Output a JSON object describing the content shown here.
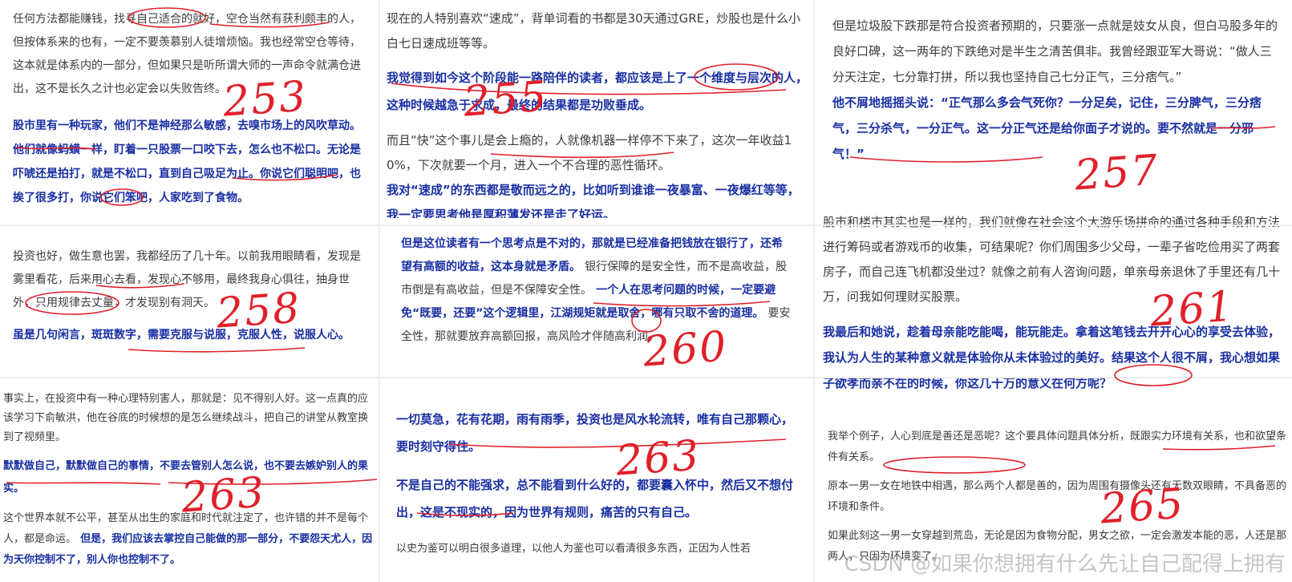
{
  "panels": [
    {
      "normal_1": "任何方法都能赚钱，找寻自己适合的就好，空仓当然有获利颇丰的人，但按体系来的也有，一定不要羡慕别人徒增烦恼。我也经常空仓等待，这本就是体系内的一部分，但如果只是听所谓大师的一声命令就满仓进出，这不是长久之计也必定会以失败告终。",
      "bold_1": "股市里有一种玩家，他们不是神经那么敏感，去嗅市场上的风吹草动。他们就像蚂蟥一样，盯着一只股票一口咬下去，怎么也不松口。无论是吓唬还是拍打，就是不松口，直到自己吸足为止。你说它们聪明吧，也挨了很多打，你说它们笨吧，人家吃到了食物。",
      "mark": "253"
    },
    {
      "normal_1": "现在的人特别喜欢“速成”，背单词看的书都是30天通过GRE，炒股也是什么小白七日速成班等等。",
      "bold_1": "我觉得到如今这个阶段能一路陪伴的读者，都应该是上了一个维度与层次的人，这种时候越急于求成，最终的结果都是功败垂成。",
      "normal_2": "而且“快”这个事儿是会上瘾的，人就像机器一样停不下来了，这次一年收益10%，下次就要一个月，进入一个不合理的恶性循环。",
      "bold_2": "我对“速成”的东西都是敬而远之的，比如听到谁谁一夜暴富、一夜爆红等等，我一定要思考他是厚积薄发还是走了好运。",
      "mark": "255"
    },
    {
      "normal_1": "但是垃圾股下跌那是符合投资者预期的，只要涨一点就是妓女从良，但白马股多年的良好口碑，这一两年的下跌绝对是半生之清苦俱非。我曾经跟亚军大哥说：“做人三分天注定，七分靠打拼，所以我也坚持自己七分正气，三分痞气。”",
      "bold_1": "他不屑地摇摇头说：“正气那么多会气死你？一分足矣，记住，三分脾气，三分痞气，三分杀气，一分正气。这一分正气还是给你面子才说的。要不然就是一分邪气！”",
      "mark": "257"
    },
    {
      "normal_1": "投资也好，做生意也罢，我都经历了几十年。以前我用眼睛看，发现是雾里看花，后来用心去看，发现心不够用，最终我身心俱往，抽身世外，只用规律去丈量，才发现别有洞天。",
      "bold_1": "虽是几句闲言，斑斑数字，需要克服与说服，克服人性，说服人心。",
      "mark": "258"
    },
    {
      "bold_1": "但是这位读者有一个思考点是不对的，那就是已经准备把钱放在银行了，还希望有高额的收益，这本身就是矛盾。",
      "normal_1": "银行保障的是安全性，而不是高收益，股市倒是有高收益，但是不保障安全性。",
      "bold_2": "一个人在思考问题的时候，一定要避免“既要，还要”这个逻辑里，江湖规矩就是取舍，哪有只取不舍的道理。",
      "normal_2": "要安全性，那就要放弃高额回报，高风险才伴随高利润。",
      "mark": "260"
    },
    {
      "normal_1": "股市和楼市其实也是一样的，我们就像在社会这个大游乐场拼命的通过各种手段和方法进行筹码或者游戏币的收集，可结果呢？你们周围多少父母，一辈子省吃俭用买了两套房子，而自己连飞机都没坐过？就像之前有人咨询问题，单亲母亲退休了手里还有几十万，问我如何理财买股票。",
      "bold_1": "我最后和她说，趁着母亲能吃能喝，能玩能走。拿着这笔钱去开开心心的享受去体验，我认为人生的某种意义就是体验你从未体验过的美好。结果这个人很不屑，我心想如果子欲孝而亲不在的时候，你这几十万的意义在何方呢？",
      "mark": "261"
    },
    {
      "normal_1": "事实上，在投资中有一种心理特别害人，那就是：见不得别人好。这一点真的应该学习下俞敏洪，他在谷底的时候想的是怎么继续战斗，把自己的讲堂从教室换到了视频里。",
      "bold_1": "默默做自己，默默做自己的事情，不要去管别人怎么说，也不要去嫉妒别人的果实。",
      "normal_2": "这个世界本就不公平，甚至从出生的家庭和时代就注定了，也许错的并不是每个人，都是命运。",
      "bold_2": "但是，我们应该去掌控自己能做的那一部分，不要怨天尤人，因为天你控制不了，别人你也控制不了。",
      "mark": "263"
    },
    {
      "bold_1": "一切莫急，花有花期，雨有雨季，投资也是风水轮流转，唯有自己那颗心，要时刻守得住。",
      "bold_2": "不是自己的不能强求，总不能看到什么好的，都要囊入怀中，然后又不想付出，这是不现实的，因为世界有规则，痛苦的只有自己。",
      "normal_1": "以史为鉴可以明白很多道理，以他人为鉴也可以看清很多东西，正因为人性若",
      "mark": "263"
    },
    {
      "normal_1": "我举个例子，人心到底是善还是恶呢？这个要具体问题具体分析，既跟实力环境有关系，也和欲望条件有关系。",
      "normal_2": "原本一男一女在地铁中相遇，那么两个人都是善的，因为周围有摄像头还有无数双眼睛，不具备恶的环境和条件。",
      "normal_3": "如果此刻这一男一女穿越到荒岛，无论是因为食物分配，男女之欲，一定会激发本能的恶，人还是那两人，只因为环境变了。",
      "mark": "265"
    }
  ],
  "watermark": "CSDN @如果你想拥有什么先让自己配得上拥有"
}
